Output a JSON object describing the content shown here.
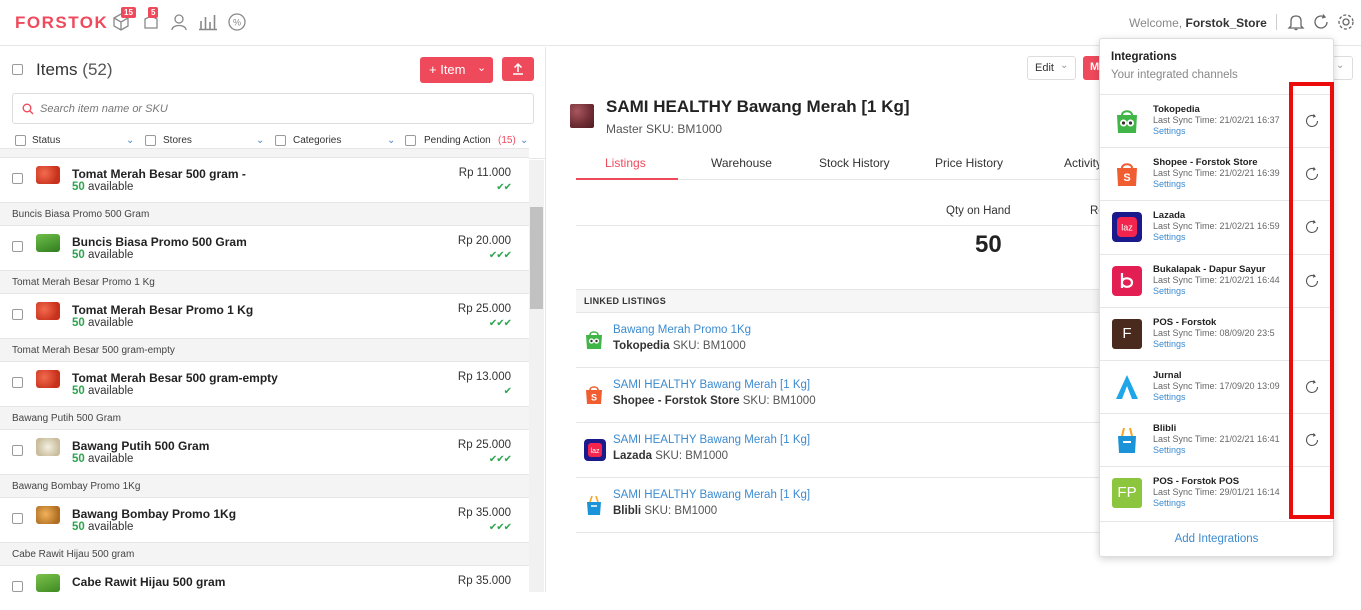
{
  "header": {
    "logo": "FORSTOK",
    "badges": {
      "orders": "15",
      "notifications": "5"
    },
    "welcome_prefix": "Welcome,",
    "store_name": "Forstok_Store"
  },
  "items_panel": {
    "title": "Items",
    "count": "(52)",
    "add_item_label": "+ Item",
    "search_placeholder": "Search item name or SKU",
    "filters": {
      "status": "Status",
      "stores": "Stores",
      "categories": "Categories",
      "pending": "Pending Action",
      "pending_count": "(15)"
    },
    "rows": [
      {
        "group": "",
        "name": "Tomat Merah Besar 500 gram -",
        "qty": "50",
        "available": "available",
        "price": "Rp 11.000",
        "ticks": "✔✔",
        "thumb": "tomato"
      },
      {
        "group": "Buncis Biasa Promo 500 Gram",
        "name": "Buncis Biasa Promo 500 Gram",
        "qty": "50",
        "available": "available",
        "price": "Rp 20.000",
        "ticks": "✔✔✔",
        "thumb": "bean"
      },
      {
        "group": "Tomat Merah Besar Promo 1 Kg",
        "name": "Tomat Merah Besar Promo 1 Kg",
        "qty": "50",
        "available": "available",
        "price": "Rp 25.000",
        "ticks": "✔✔✔",
        "thumb": "tomato"
      },
      {
        "group": "Tomat Merah Besar 500 gram-empty",
        "name": "Tomat Merah Besar 500 gram-empty",
        "qty": "50",
        "available": "available",
        "price": "Rp 13.000",
        "ticks": "✔",
        "thumb": "tomato"
      },
      {
        "group": "Bawang Putih 500 Gram",
        "name": "Bawang Putih 500 Gram",
        "qty": "50",
        "available": "available",
        "price": "Rp 25.000",
        "ticks": "✔✔✔",
        "thumb": "garlic"
      },
      {
        "group": "Bawang Bombay Promo 1Kg",
        "name": "Bawang Bombay Promo 1Kg",
        "qty": "50",
        "available": "available",
        "price": "Rp 35.000",
        "ticks": "✔✔✔",
        "thumb": "onion"
      },
      {
        "group": "Cabe Rawit Hijau 500 gram",
        "name": "Cabe Rawit Hijau 500 gram",
        "qty": "",
        "available": "",
        "price": "Rp 35.000",
        "ticks": "",
        "thumb": "chili"
      }
    ]
  },
  "product": {
    "title": "SAMI HEALTHY Bawang Merah [1 Kg]",
    "sku_label": "Master SKU:",
    "sku": "BM1000",
    "edit_label": "Edit",
    "more_label": "M",
    "tabs": [
      "Listings",
      "Warehouse",
      "Stock History",
      "Price History",
      "Activity"
    ],
    "qty_label": "Qty on Hand",
    "qty_value": "50",
    "partial_col": "Re",
    "linked_header": "LINKED LISTINGS",
    "listings": [
      {
        "title": "Bawang Merah Promo 1Kg",
        "channel": "Tokopedia",
        "sku": "SKU: BM1000",
        "icon": "tokopedia-icon"
      },
      {
        "title": "SAMI HEALTHY Bawang Merah [1 Kg]",
        "channel": "Shopee - Forstok Store",
        "sku": "SKU: BM1000",
        "icon": "shopee-icon"
      },
      {
        "title": "SAMI HEALTHY Bawang Merah [1 Kg]",
        "channel": "Lazada",
        "sku": "SKU: BM1000",
        "icon": "lazada-icon"
      },
      {
        "title": "SAMI HEALTHY Bawang Merah [1 Kg]",
        "channel": "Blibli",
        "sku": "SKU: BM1000",
        "icon": "blibli-icon"
      }
    ]
  },
  "integrations": {
    "title": "Integrations",
    "subtitle": "Your integrated channels",
    "add_label": "Add Integrations",
    "items": [
      {
        "name": "Tokopedia",
        "time": "Last Sync Time: 21/02/21 16:37",
        "settings": "Settings",
        "sync": true,
        "icon": "tokopedia-icon"
      },
      {
        "name": "Shopee - Forstok Store",
        "time": "Last Sync Time: 21/02/21 16:39",
        "settings": "Settings",
        "sync": true,
        "icon": "shopee-icon"
      },
      {
        "name": "Lazada",
        "time": "Last Sync Time: 21/02/21 16:59",
        "settings": "Settings",
        "sync": true,
        "icon": "lazada-icon"
      },
      {
        "name": "Bukalapak - Dapur Sayur",
        "time": "Last Sync Time: 21/02/21 16:44",
        "settings": "Settings",
        "sync": true,
        "icon": "bukalapak-icon"
      },
      {
        "name": "POS - Forstok",
        "time": "Last Sync Time: 08/09/20 23:5",
        "settings": "Settings",
        "sync": false,
        "icon": "pos-f-icon",
        "letter": "F"
      },
      {
        "name": "Jurnal",
        "time": "Last Sync Time: 17/09/20 13:09",
        "settings": "Settings",
        "sync": true,
        "icon": "jurnal-icon"
      },
      {
        "name": "Blibli",
        "time": "Last Sync Time: 21/02/21 16:41",
        "settings": "Settings",
        "sync": true,
        "icon": "blibli-icon"
      },
      {
        "name": "POS - Forstok POS",
        "time": "Last Sync Time: 29/01/21 16:14",
        "settings": "Settings",
        "sync": false,
        "icon": "pos-fp-icon",
        "letter": "FP"
      }
    ]
  },
  "colors": {
    "brand": "#ef4a5c",
    "link": "#3c8bd0",
    "available": "#2ea44f",
    "highlight": "#ec0b0b"
  }
}
